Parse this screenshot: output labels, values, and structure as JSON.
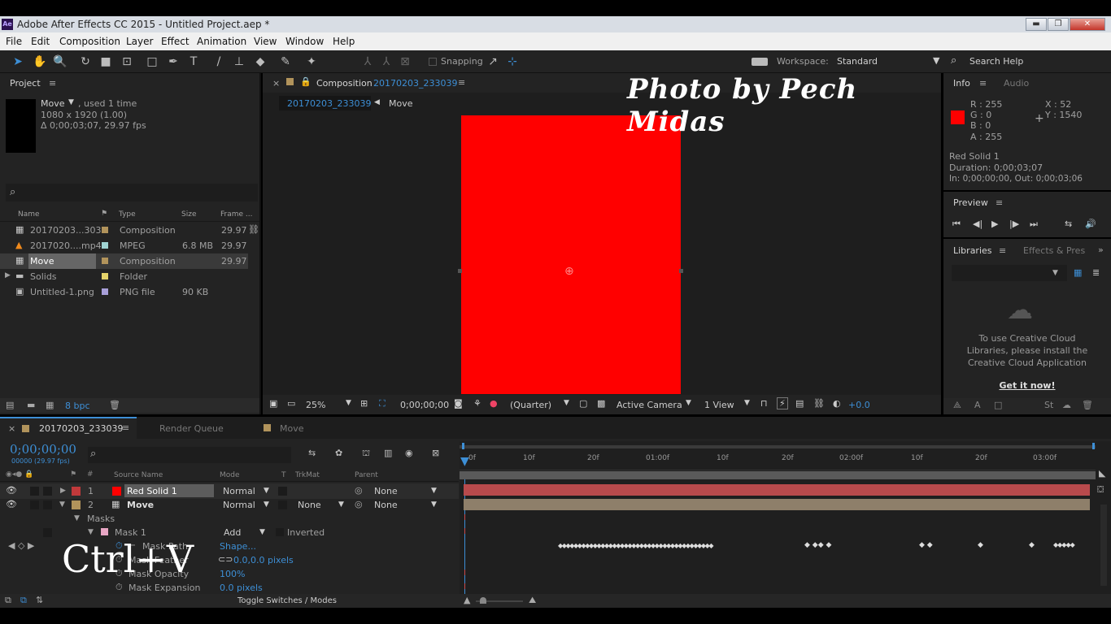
{
  "app": {
    "window_title": "Adobe After Effects CC 2015 - Untitled Project.aep *",
    "icon_text": "Ae"
  },
  "window_buttons": {
    "minimize": "▬",
    "restore": "❐",
    "close": "✕"
  },
  "menu": [
    "File",
    "Edit",
    "Composition",
    "Layer",
    "Effect",
    "Animation",
    "View",
    "Window",
    "Help"
  ],
  "toolbar": {
    "snapping_label": "Snapping",
    "workspace_label": "Workspace:",
    "workspace_value": "Standard",
    "search_help": "Search Help"
  },
  "watermark": "Photo by Pech Midas",
  "project": {
    "title": "Project",
    "selected_name": "Move",
    "selected_used": ", used 1 time",
    "selected_res": "1080 x 1920 (1.00)",
    "selected_dur": "Δ 0;00;03;07, 29.97 fps",
    "search_placeholder": "",
    "columns": [
      "Name",
      "Type",
      "Size",
      "Frame ..."
    ],
    "items": [
      {
        "name": "20170203...3039",
        "type": "Composition",
        "size": "",
        "fps": "29.97",
        "label": "#b1935b",
        "icon": "composition-icon"
      },
      {
        "name": "2017020....mp4",
        "type": "MPEG",
        "size": "6.8 MB",
        "fps": "29.97",
        "label": "#9fd3d2",
        "icon": "vlc-icon"
      },
      {
        "name": "Move",
        "type": "Composition",
        "size": "",
        "fps": "29.97",
        "label": "#b1935b",
        "icon": "composition-icon"
      },
      {
        "name": "Solids",
        "type": "Folder",
        "size": "",
        "fps": "",
        "label": "#e5d36a",
        "icon": "folder-icon"
      },
      {
        "name": "Untitled-1.png",
        "type": "PNG file",
        "size": "90 KB",
        "fps": "",
        "label": "#a89fd8",
        "icon": "image-file-icon"
      }
    ],
    "bpc": "8 bpc"
  },
  "composition": {
    "panel_label": "Composition",
    "comp_name": "20170203_233039",
    "tab_active": "20170203_233039",
    "tab_other": "Move",
    "solid_color": "#ff0000",
    "zoom": "25%",
    "timecode": "0;00;00;00",
    "resolution": "(Quarter)",
    "camera": "Active Camera",
    "views": "1 View",
    "exposure": "+0.0"
  },
  "info": {
    "tab_info": "Info",
    "tab_audio": "Audio",
    "r": "R : 255",
    "g": "G : 0",
    "b": "B : 0",
    "a": "A : 255",
    "x": "X : 52",
    "y": "Y : 1540",
    "swatch": "#ff0000",
    "layer_name": "Red Solid 1",
    "duration": "Duration: 0;00;03;07",
    "inout": "In: 0;00;00;00, Out: 0;00;03;06"
  },
  "preview": {
    "title": "Preview"
  },
  "libraries": {
    "tab_libraries": "Libraries",
    "tab_effects": "Effects & Pres",
    "message": "To use Creative Cloud Libraries, please install the Creative Cloud Application",
    "link": "Get it now!"
  },
  "timeline": {
    "tabs": [
      "20170203_233039",
      "Render Queue",
      "Move"
    ],
    "current_time": "0;00;00;00",
    "fps_info": "00000 (29.97 fps)",
    "headers": {
      "source": "Source Name",
      "mode": "Mode",
      "t": "T",
      "trkmat": "TrkMat",
      "parent": "Parent"
    },
    "ruler": [
      "0f",
      "10f",
      "20f",
      "01:00f",
      "10f",
      "20f",
      "02:00f",
      "10f",
      "20f",
      "03:00f"
    ],
    "layers": [
      {
        "num": "1",
        "name": "Red Solid 1",
        "mode": "Normal",
        "trkmat": "",
        "parent": "None",
        "label": "#c0393b",
        "bar": "#b84a4c"
      },
      {
        "num": "2",
        "name": "Move",
        "mode": "Normal",
        "trkmat": "None",
        "parent": "None",
        "label": "#b1935b",
        "bar": "#8e7f6a"
      }
    ],
    "masks_label": "Masks",
    "mask1": "Mask 1",
    "mask_mode": "Add",
    "inverted": "Inverted",
    "props": [
      {
        "name": "Mask Path",
        "value": "Shape..."
      },
      {
        "name": "Mask Feather",
        "value": "0.0,0.0 pixels"
      },
      {
        "name": "Mask Opacity",
        "value": "100%"
      },
      {
        "name": "Mask Expansion",
        "value": "0.0 pixels"
      }
    ],
    "keyframes_text": "◆◆◆◆◆◆◆◆◆◆◆◆◆◆◆◆◆◆◆◆◆◆◆◆◆◆◆◆◆◆◆◆◆◆◆◆◆◆◆◆",
    "toggle": "Toggle Switches / Modes",
    "overlay_text": "Ctrl+V"
  }
}
